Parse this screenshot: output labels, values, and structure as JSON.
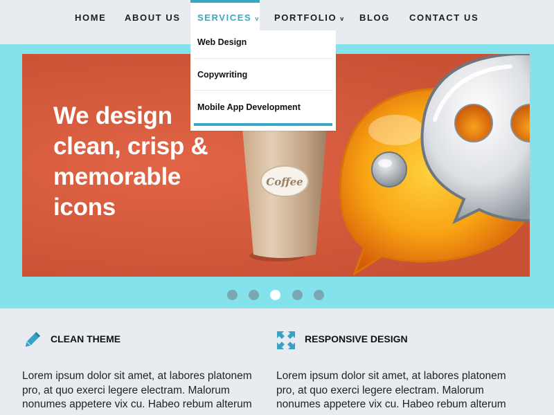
{
  "nav": {
    "items": [
      {
        "label": "HOME",
        "caret": ""
      },
      {
        "label": "ABOUT US",
        "caret": ""
      },
      {
        "label": "SERVICES",
        "caret": "v"
      },
      {
        "label": "PORTFOLIO",
        "caret": "v"
      },
      {
        "label": "BLOG",
        "caret": ""
      },
      {
        "label": "CONTACT US",
        "caret": ""
      }
    ],
    "active": "SERVICES",
    "accent_color": "#38a8c3"
  },
  "dropdown": {
    "items": [
      "Web Design",
      "Copywriting",
      "Mobile App Development"
    ]
  },
  "hero": {
    "headline_lines": [
      "We design",
      "clean, crisp &",
      "memorable",
      "icons"
    ],
    "cup_label": "Coffee",
    "band_color": "#84e2ec",
    "slide_color": "#e05b3b",
    "slider": {
      "count": 5,
      "active_index": 3
    }
  },
  "features": [
    {
      "icon": "pencil-icon",
      "title": "CLEAN THEME",
      "text": "Lorem ipsum dolor sit amet, at labores platonem pro, at quo exerci legere electram. Malorum nonumes appetere vix cu. Habeo rebum alterum"
    },
    {
      "icon": "expand-arrows-icon",
      "title": "RESPONSIVE DESIGN",
      "text": "Lorem ipsum dolor sit amet, at labores platonem pro, at quo exerci legere electram. Malorum nonumes appetere vix cu. Habeo rebum alterum"
    }
  ]
}
